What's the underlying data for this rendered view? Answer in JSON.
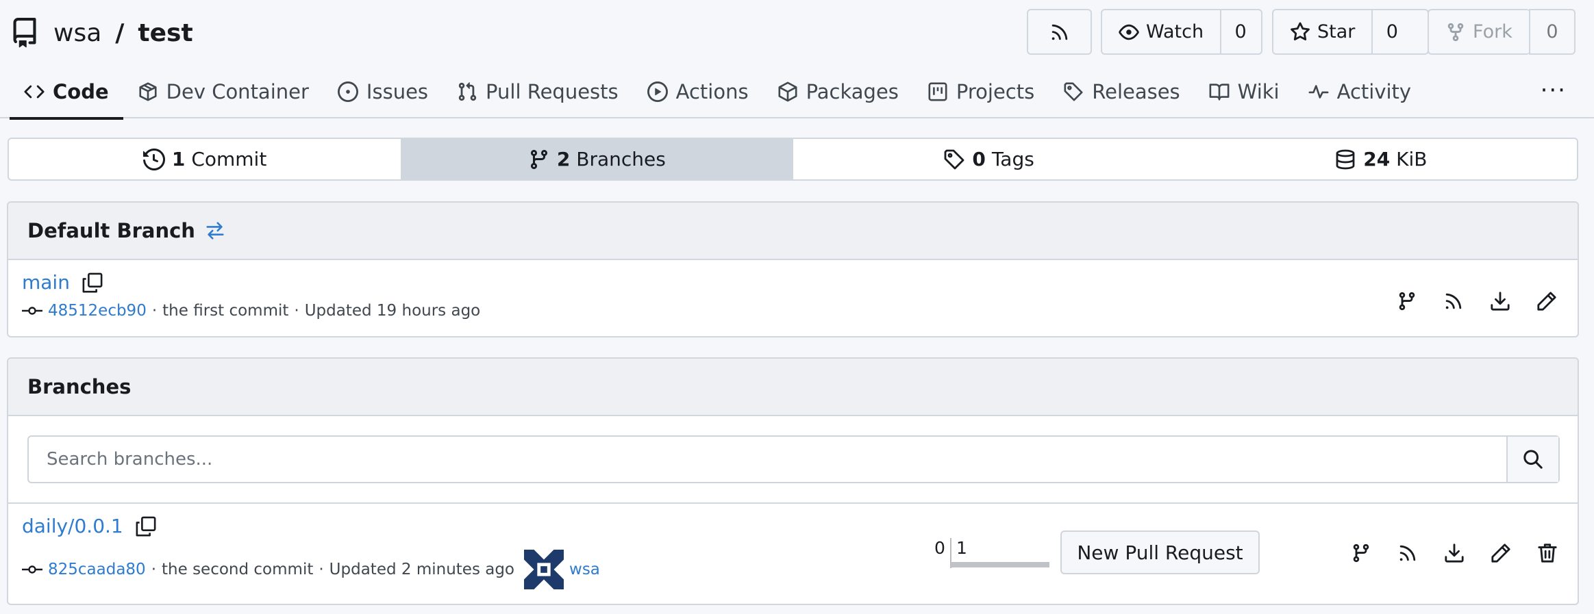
{
  "repo": {
    "owner": "wsa",
    "separator": "/",
    "name": "test"
  },
  "header_buttons": {
    "watch": {
      "label": "Watch",
      "count": "0"
    },
    "star": {
      "label": "Star",
      "count": "0"
    },
    "fork": {
      "label": "Fork",
      "count": "0"
    }
  },
  "tabs": [
    {
      "label": "Code",
      "icon": "code-icon",
      "active": true
    },
    {
      "label": "Dev Container",
      "icon": "container-icon"
    },
    {
      "label": "Issues",
      "icon": "issue-icon"
    },
    {
      "label": "Pull Requests",
      "icon": "pull-request-icon"
    },
    {
      "label": "Actions",
      "icon": "play-icon"
    },
    {
      "label": "Packages",
      "icon": "package-icon"
    },
    {
      "label": "Projects",
      "icon": "project-icon"
    },
    {
      "label": "Releases",
      "icon": "tag-icon"
    },
    {
      "label": "Wiki",
      "icon": "book-icon"
    },
    {
      "label": "Activity",
      "icon": "pulse-icon"
    }
  ],
  "more_label": "···",
  "stats": {
    "commits": {
      "count": "1",
      "label": "Commit"
    },
    "branches": {
      "count": "2",
      "label": "Branches"
    },
    "tags": {
      "count": "0",
      "label": "Tags"
    },
    "size": {
      "count": "24",
      "label": "KiB"
    }
  },
  "default_branch": {
    "heading": "Default Branch",
    "name": "main",
    "sha": "48512ecb90",
    "message": "the first commit",
    "updated": "Updated 19 hours ago"
  },
  "branches": {
    "heading": "Branches",
    "search_placeholder": "Search branches...",
    "items": [
      {
        "name": "daily/0.0.1",
        "sha": "825caada80",
        "message": "the second  commit",
        "updated": "Updated 2 minutes ago",
        "author": "wsa",
        "behind": "0",
        "ahead": "1",
        "new_pr_label": "New Pull Request"
      }
    ]
  },
  "meta_separator": "·",
  "colors": {
    "link": "#2e7bcf",
    "active_stat": "#d0d6de",
    "panel_head": "#eef0f3"
  }
}
